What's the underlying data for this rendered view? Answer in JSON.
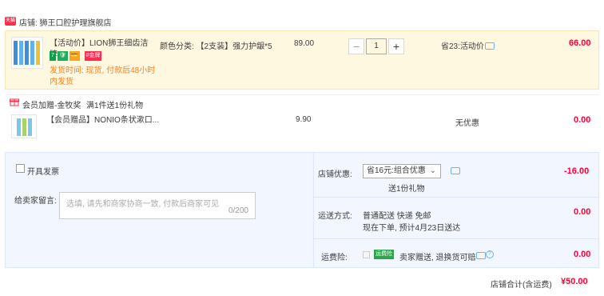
{
  "store": {
    "badge": "天猫",
    "name": "店铺: 狮王口腔护理旗舰店"
  },
  "item": {
    "title_line1": "【活动价】LION狮王细齿洁牌...",
    "sku": "颜色分类: 【2支装】强力护龈*5",
    "tags": [
      "7",
      "🛡",
      "💳",
      "#金牌"
    ],
    "ship_line1": "发货时间: 现货, 付款后48小时",
    "ship_line2": "内发货",
    "price": "89.00",
    "qty_minus": "−",
    "qty_value": "1",
    "qty_plus": "+",
    "discount": "省23:活动价",
    "subtotal": "66.00"
  },
  "gift": {
    "label": "会员加赠-金牧奖",
    "promo": "满1件送1份礼物",
    "title": "【会员赠品】NONIO条状漱口...",
    "price": "9.90",
    "discount": "无优惠",
    "subtotal": "0.00"
  },
  "options": {
    "invoice_label": "开具发票",
    "remark_label": "给卖家留言:",
    "remark_placeholder": "选填, 请先和商家协商一致, 付款后商家可见",
    "remark_counter": "0/200"
  },
  "store_discount": {
    "label": "店铺优惠:",
    "select_value": "省16元:组合优惠",
    "note": "送1份礼物",
    "amount": "-16.00"
  },
  "shipping": {
    "label": "运送方式:",
    "method": "普通配送 快递 免邮",
    "eta": "现在下单, 预计4月23日送达",
    "amount": "0.00"
  },
  "insurance": {
    "label": "运费险:",
    "badge": "运费险",
    "desc": "卖家赠送, 退换货可赔",
    "amount": "0.00"
  },
  "total": {
    "label": "店铺合计(含运费)",
    "amount": "¥50.00"
  }
}
